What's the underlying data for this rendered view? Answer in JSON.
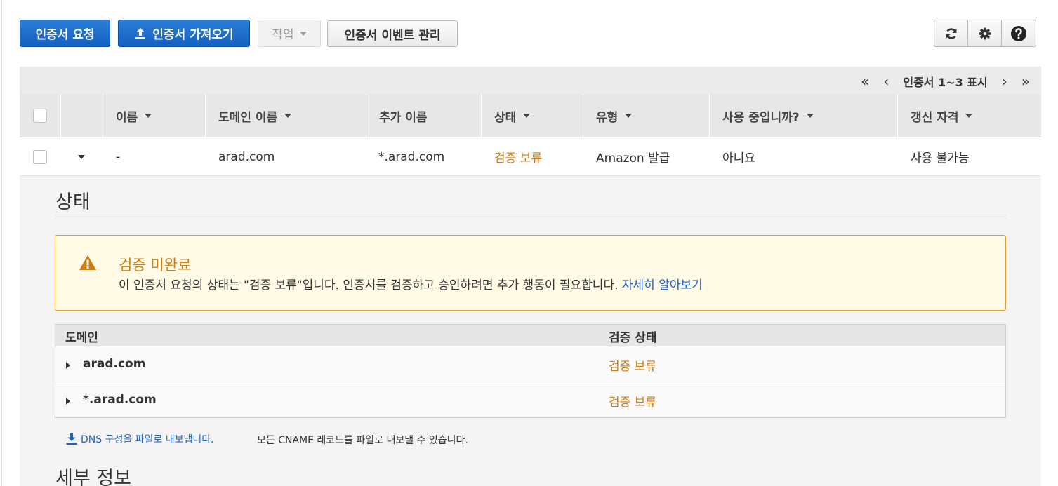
{
  "toolbar": {
    "request_label": "인증서 요청",
    "import_label": "인증서 가져오기",
    "actions_label": "작업",
    "events_label": "인증서 이벤트 관리"
  },
  "pager": {
    "label": "인증서 1~3 표시"
  },
  "table": {
    "headers": {
      "name": "이름",
      "domain": "도메인 이름",
      "additional": "추가 이름",
      "status": "상태",
      "type": "유형",
      "in_use": "사용 중입니까?",
      "renewal": "갱신 자격"
    },
    "row": {
      "name": "-",
      "domain": "arad.com",
      "additional": "*.arad.com",
      "status": "검증 보류",
      "type": "Amazon 발급",
      "in_use": "아니요",
      "renewal": "사용 불가능"
    }
  },
  "detail": {
    "status_heading": "상태",
    "alert": {
      "title": "검증 미완료",
      "message": "이 인증서 요청의 상태는 \"검증 보류\"입니다. 인증서를 검증하고 승인하려면 추가 행동이 필요합니다.",
      "link": "자세히 알아보기"
    },
    "domains": {
      "header_domain": "도메인",
      "header_status": "검증 상태",
      "rows": [
        {
          "domain": "arad.com",
          "status": "검증 보류"
        },
        {
          "domain": "*.arad.com",
          "status": "검증 보류"
        }
      ]
    },
    "export_link": "DNS 구성을 파일로 내보냅니다.",
    "export_note": "모든 CNAME 레코드를 파일로 내보낼 수 있습니다.",
    "details_heading": "세부 정보"
  },
  "colors": {
    "primary": "#1a6bcc",
    "pending": "#d07a0f",
    "link": "#1f63c6",
    "alert_border": "#e19c2b"
  }
}
